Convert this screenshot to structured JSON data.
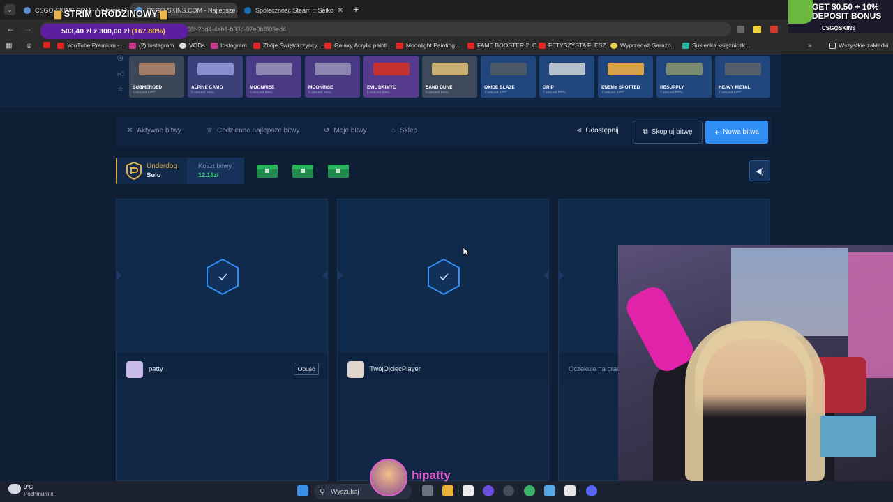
{
  "browser": {
    "tabs": [
      {
        "title": "CSGO-SKINS.COM - Najlepsze",
        "active": false
      },
      {
        "title": "CSGO-SKINS.COM - Najlepsze",
        "active": true
      },
      {
        "title": "Społeczność Steam :: Seiko",
        "active": false
      }
    ],
    "new_tab": "+",
    "url": "08f-2bd4-4ab1-b33d-97e0bf803ed4",
    "bookmarks": [
      "YouTube Premium -...",
      "(2) Instagram",
      "VODs",
      "Instagram",
      "Zbóje Świętokrzyscy...",
      "Galaxy Acrylic painti...",
      "Moonlight Painting...",
      "FAME BOOSTER 2: C...",
      "FETYSZYSTA FLESZ...",
      "Wyprzedaż Garażo...",
      "Sukienka księżniczk..."
    ],
    "all_bookmarks": "Wszystkie zakładki"
  },
  "overlay": {
    "title": "STRIM URODZINOWY",
    "goal_amount": "503,40 zł z 300,00 zł",
    "goal_pct": "(167.80%)",
    "ad_line1": "GET $0.50 + 10%",
    "ad_line2": "DEPOSIT BONUS",
    "ad_brand": "CSG⊙SKINS",
    "streamer": "hipatty"
  },
  "live_drops": [
    {
      "name": "SUBMERGED",
      "time": "5 sekund temu",
      "bg": "#3b4656",
      "gun": "#a07c68"
    },
    {
      "name": "ALPINE CAMO",
      "time": "5 sekund temu",
      "bg": "#3b3f7a",
      "gun": "#8c8fcf"
    },
    {
      "name": "MOONRISE",
      "time": "5 sekund temu",
      "bg": "#4a3a86",
      "gun": "#8a86b0"
    },
    {
      "name": "MOONRISE",
      "time": "5 sekund temu",
      "bg": "#4a3a86",
      "gun": "#8a86b0"
    },
    {
      "name": "EVIL DAIMYO",
      "time": "5 sekund temu",
      "bg": "#563a8e",
      "gun": "#c2302f"
    },
    {
      "name": "SAND DUNE",
      "time": "6 sekund temu",
      "bg": "#3e4a5c",
      "gun": "#c9ae74"
    },
    {
      "name": "OXIDE BLAZE",
      "time": "7 sekund temu",
      "bg": "#20467d",
      "gun": "#4a5868"
    },
    {
      "name": "GRIP",
      "time": "7 sekund temu",
      "bg": "#20467d",
      "gun": "#b4c0cc"
    },
    {
      "name": "ENEMY SPOTTED",
      "time": "7 sekund temu",
      "bg": "#20467d",
      "gun": "#d8a24a"
    },
    {
      "name": "RESUPPLY",
      "time": "7 sekund temu",
      "bg": "#20467d",
      "gun": "#7a8a70"
    },
    {
      "name": "HEAVY METAL",
      "time": "7 sekund temu",
      "bg": "#20467d",
      "gun": "#55606c"
    }
  ],
  "nav": {
    "active_battles": "Aktywne bitwy",
    "daily_best": "Codzienne najlepsze bitwy",
    "my_battles": "Moje bitwy",
    "shop": "Sklep",
    "share": "Udostępnij",
    "copy": "Skopiuj bitwę",
    "new": "Nowa bitwa"
  },
  "battle": {
    "mode": "Underdog",
    "type": "Solo",
    "cost_label": "Koszt bitwy",
    "cost_value": "12.18zł"
  },
  "players": [
    {
      "name": "patty",
      "action": "Opuść"
    },
    {
      "name": "TwójOjciecPlayer"
    },
    {
      "name": "Oczekuje na grac"
    }
  ],
  "taskbar": {
    "temp": "9°C",
    "weather": "Pochmurnie",
    "search": "Wyszukaj"
  }
}
